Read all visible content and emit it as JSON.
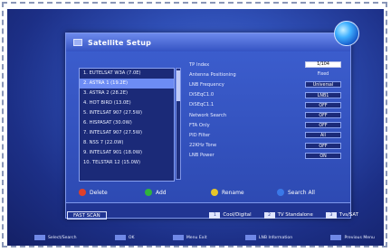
{
  "window": {
    "title": "Satellite Setup"
  },
  "satellites": [
    "1. EUTELSAT W3A (7.0E)",
    "2. ASTRA 1 (19.2E)",
    "3. ASTRA 2 (28.2E)",
    "4. HOT BIRD (13.0E)",
    "5. INTELSAT 907 (27.5W)",
    "6. HISPASAT (30.0W)",
    "7. INTELSAT 907 (27.5W)",
    "8. NSS 7 (22.0W)",
    "9. INTELSAT 901 (18.0W)",
    "10. TELSTAR 12 (15.0W)"
  ],
  "settings": [
    {
      "label": "TP Index",
      "value": "1/104",
      "style": "input"
    },
    {
      "label": "Antenna Positioning",
      "value": "Fixed",
      "style": "plain"
    },
    {
      "label": "LNB Frequency",
      "value": "Universal",
      "style": "box"
    },
    {
      "label": "DiSEqC1.0",
      "value": "LNB1",
      "style": "box"
    },
    {
      "label": "DiSEqC1.1",
      "value": "OFF",
      "style": "box"
    },
    {
      "label": "Network Search",
      "value": "OFF",
      "style": "box"
    },
    {
      "label": "FTA Only",
      "value": "OFF",
      "style": "box"
    },
    {
      "label": "PID Filter",
      "value": "All",
      "style": "box"
    },
    {
      "label": "22KHz Tone",
      "value": "OFF",
      "style": "box"
    },
    {
      "label": "LNB Power",
      "value": "ON",
      "style": "box"
    }
  ],
  "color_keys": [
    {
      "label": "Delete",
      "color": "#e0402a"
    },
    {
      "label": "Add",
      "color": "#2fb43c"
    },
    {
      "label": "Rename",
      "color": "#e6c62a"
    },
    {
      "label": "Search All",
      "color": "#3a78e8"
    }
  ],
  "help": {
    "fast_scan": "FAST SCAN",
    "items": [
      {
        "key": "1",
        "label": "Cool/Digital"
      },
      {
        "key": "2",
        "label": "TV Standalone"
      },
      {
        "key": "3",
        "label": "Tvs/SAT"
      }
    ]
  },
  "bottom_help": [
    {
      "label": "Select/Search"
    },
    {
      "label": "OK"
    },
    {
      "label": "Menu Exit"
    },
    {
      "label": "LNB Information"
    },
    {
      "label": "Previous Menu"
    }
  ]
}
